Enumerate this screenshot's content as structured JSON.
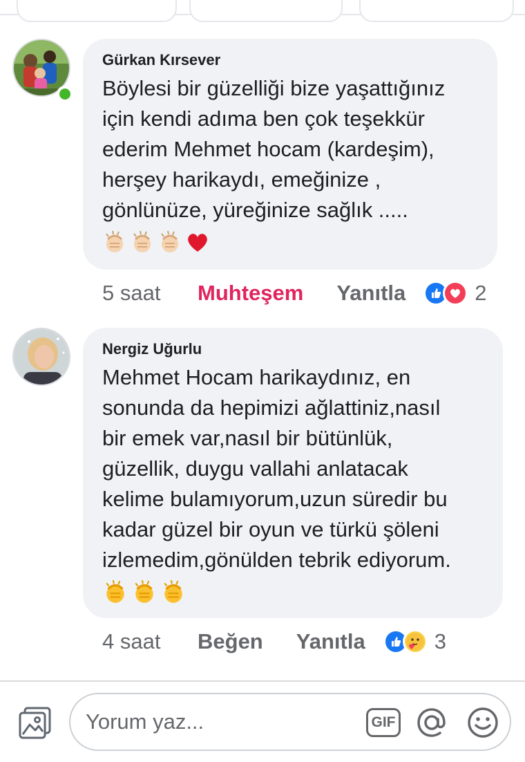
{
  "comments": [
    {
      "author": "Gürkan Kırsever",
      "text": "Böylesi bir güzelliği bize yaşattığınız\niçin kendi adıma ben çok teşekkür\nederim Mehmet hocam (kardeşim),\nherşey harikaydı, emeğinize ,\ngönlünüze, yüreğinize sağlık .....",
      "emojis": [
        "clapping-hands-light",
        "clapping-hands-light",
        "clapping-hands-light",
        "red-heart"
      ],
      "time": "5 saat",
      "reaction_label": "Muhteşem",
      "reaction_color": "#e0245e",
      "reply_label": "Yanıtla",
      "reaction_icons": [
        "like-icon",
        "love-icon"
      ],
      "reaction_count": "2",
      "online": true
    },
    {
      "author": "Nergiz Uğurlu",
      "text": "Mehmet Hocam harikaydınız, en\nsonunda da hepimizi ağlattiniz,nasıl\nbir emek var,nasıl bir bütünlük,\ngüzellik, duygu vallahi anlatacak\nkelime bulamıyorum,uzun süredir bu\nkadar güzel bir oyun ve türkü şöleni\nizlemedim,gönülden tebrik ediyorum.",
      "emojis": [
        "clapping-hands-yellow",
        "clapping-hands-yellow",
        "clapping-hands-yellow"
      ],
      "time": "4 saat",
      "reaction_label": "Beğen",
      "reaction_color": "#65676b",
      "reply_label": "Yanıtla",
      "reaction_icons": [
        "like-icon",
        "care-icon"
      ],
      "reaction_count": "3",
      "online": false
    }
  ],
  "composer": {
    "placeholder": "Yorum yaz...",
    "gif_label": "GIF"
  },
  "colors": {
    "like_blue": "#1877f2",
    "love_red": "#f33e58",
    "online_green": "#42b72a",
    "bubble_bg": "#f0f2f5"
  }
}
